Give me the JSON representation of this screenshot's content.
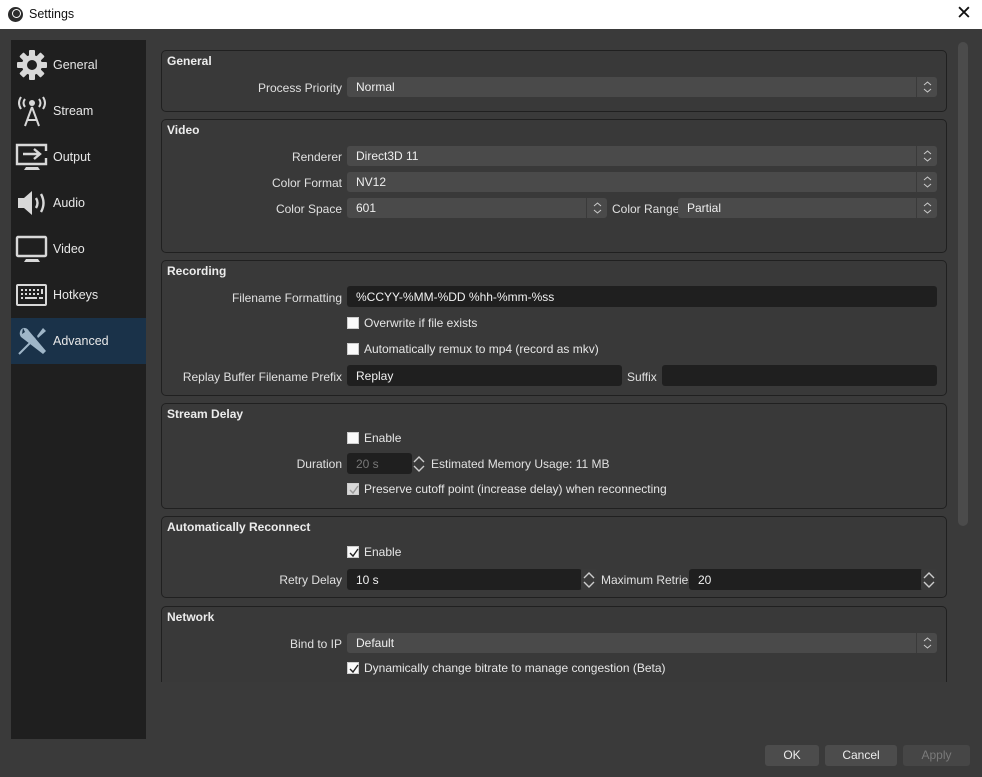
{
  "window": {
    "title": "Settings",
    "close_icon": "close-icon"
  },
  "sidebar": {
    "items": [
      {
        "label": "General",
        "icon": "gear-icon",
        "active": false
      },
      {
        "label": "Stream",
        "icon": "antenna-icon",
        "active": false
      },
      {
        "label": "Output",
        "icon": "output-monitor-icon",
        "active": false
      },
      {
        "label": "Audio",
        "icon": "speaker-icon",
        "active": false
      },
      {
        "label": "Video",
        "icon": "monitor-icon",
        "active": false
      },
      {
        "label": "Hotkeys",
        "icon": "keyboard-icon",
        "active": false
      },
      {
        "label": "Advanced",
        "icon": "tools-icon",
        "active": true
      }
    ]
  },
  "general": {
    "title": "General",
    "process_priority": {
      "label": "Process Priority",
      "value": "Normal"
    }
  },
  "video": {
    "title": "Video",
    "renderer": {
      "label": "Renderer",
      "value": "Direct3D 11"
    },
    "color_format": {
      "label": "Color Format",
      "value": "NV12"
    },
    "color_space": {
      "label": "Color Space",
      "value": "601"
    },
    "color_range": {
      "label": "Color Range",
      "value": "Partial"
    }
  },
  "recording": {
    "title": "Recording",
    "filename_formatting": {
      "label": "Filename Formatting",
      "value": "%CCYY-%MM-%DD %hh-%mm-%ss"
    },
    "overwrite": {
      "label": "Overwrite if file exists",
      "checked": false
    },
    "remux": {
      "label": "Automatically remux to mp4 (record as mkv)",
      "checked": false
    },
    "replay_prefix": {
      "label": "Replay Buffer Filename Prefix",
      "value": "Replay"
    },
    "replay_suffix": {
      "label": "Suffix",
      "value": ""
    }
  },
  "stream_delay": {
    "title": "Stream Delay",
    "enable": {
      "label": "Enable",
      "checked": false
    },
    "duration": {
      "label": "Duration",
      "value": "20 s"
    },
    "memory_usage": "Estimated Memory Usage: 11 MB",
    "preserve": {
      "label": "Preserve cutoff point (increase delay) when reconnecting",
      "checked": true
    }
  },
  "auto_reconnect": {
    "title": "Automatically Reconnect",
    "enable": {
      "label": "Enable",
      "checked": true
    },
    "retry_delay": {
      "label": "Retry Delay",
      "value": "10 s"
    },
    "max_retries": {
      "label": "Maximum Retries",
      "value": "20"
    }
  },
  "network": {
    "title": "Network",
    "bind_to_ip": {
      "label": "Bind to IP",
      "value": "Default"
    },
    "dynamic_bitrate": {
      "label": "Dynamically change bitrate to manage congestion (Beta)",
      "checked": true
    }
  },
  "footer": {
    "ok": "OK",
    "cancel": "Cancel",
    "apply": "Apply"
  },
  "colors": {
    "accent": "#1a3249",
    "background": "#3a3a3a",
    "sidebar": "#1f1f1f"
  }
}
